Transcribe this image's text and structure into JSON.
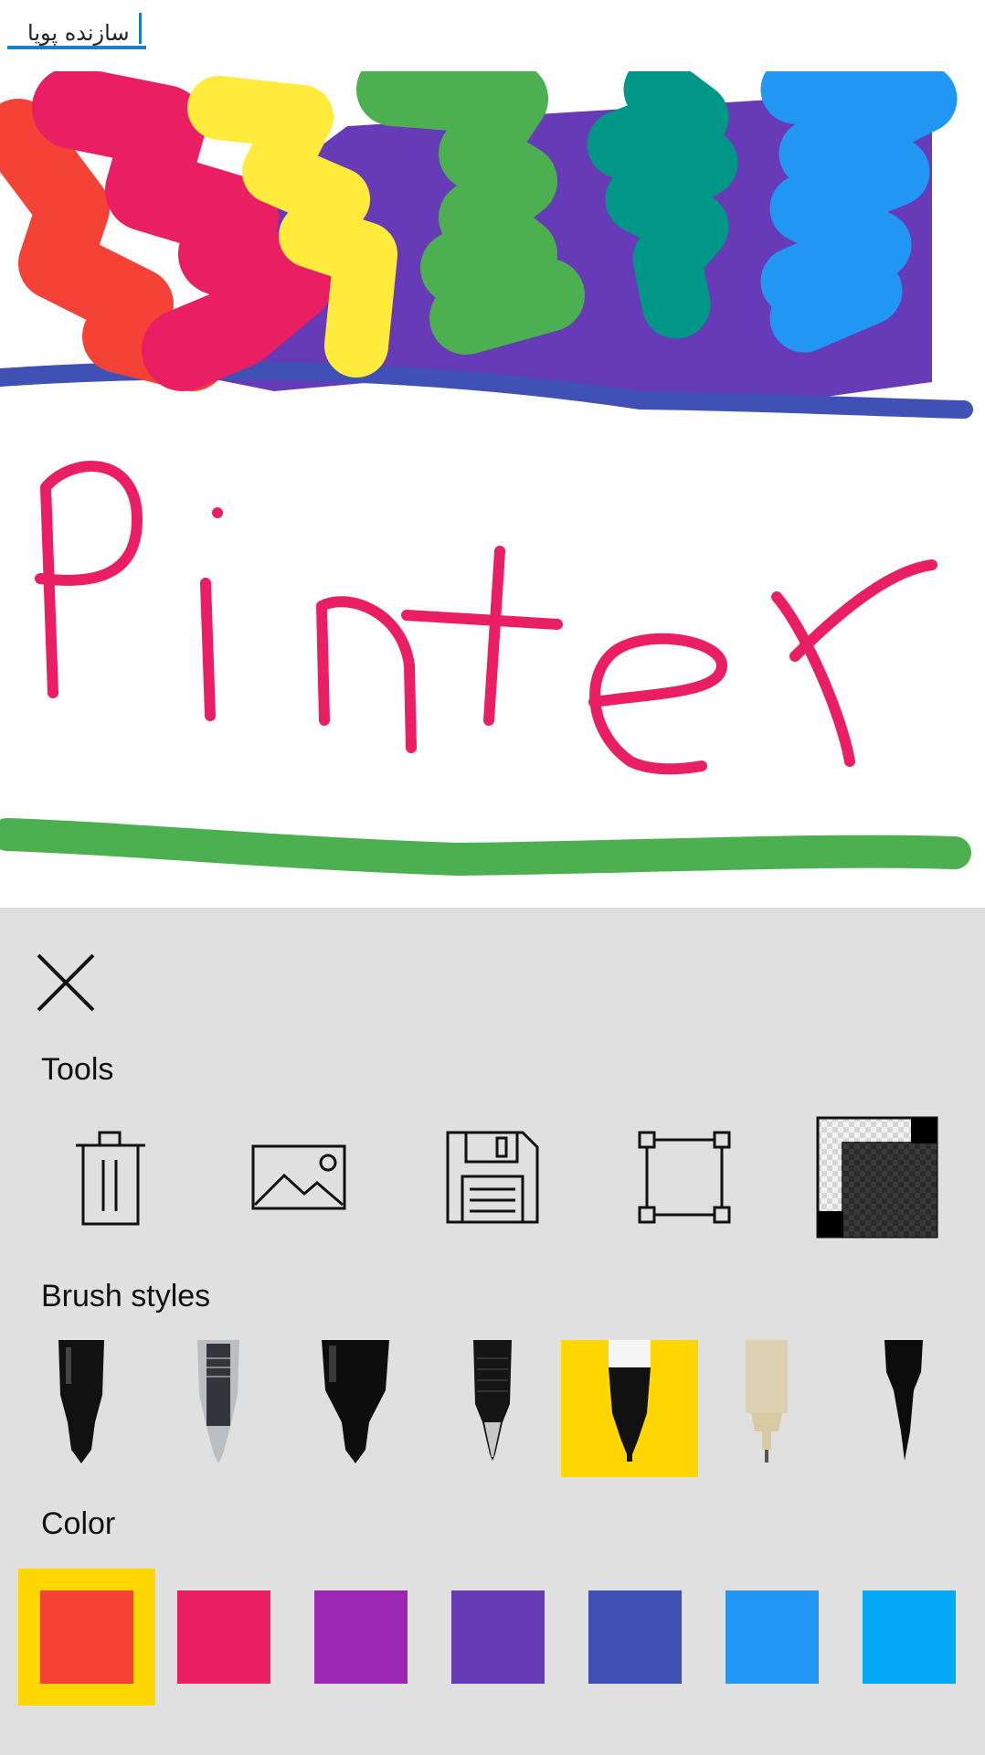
{
  "header": {
    "title_value": "سازنده پویا"
  },
  "canvas": {
    "written_text": "Pinter",
    "stroke_colors": [
      "#f44336",
      "#e91e63",
      "#ffeb3b",
      "#673ab7",
      "#4caf50",
      "#009688",
      "#2196f3",
      "#3f51b5"
    ]
  },
  "panel": {
    "close_icon": "close-icon",
    "tools_label": "Tools",
    "tools": [
      {
        "name": "trash-icon"
      },
      {
        "name": "image-icon"
      },
      {
        "name": "save-icon"
      },
      {
        "name": "crop-frame-icon"
      },
      {
        "name": "background-toggle-icon"
      }
    ],
    "brush_label": "Brush styles",
    "brushes": [
      {
        "name": "marker-pen-brush"
      },
      {
        "name": "gel-pen-brush"
      },
      {
        "name": "felt-tip-brush"
      },
      {
        "name": "ballpoint-brush"
      },
      {
        "name": "fineliner-brush",
        "selected": true
      },
      {
        "name": "technical-pen-brush"
      },
      {
        "name": "brush-pen-brush"
      }
    ],
    "color_label": "Color",
    "colors": [
      "#f44336",
      "#e91e63",
      "#9c27b0",
      "#673ab7",
      "#3f51b5",
      "#2196f3",
      "#03a9f4"
    ],
    "selected_color_index": 0,
    "selection_color": "#ffd600"
  }
}
